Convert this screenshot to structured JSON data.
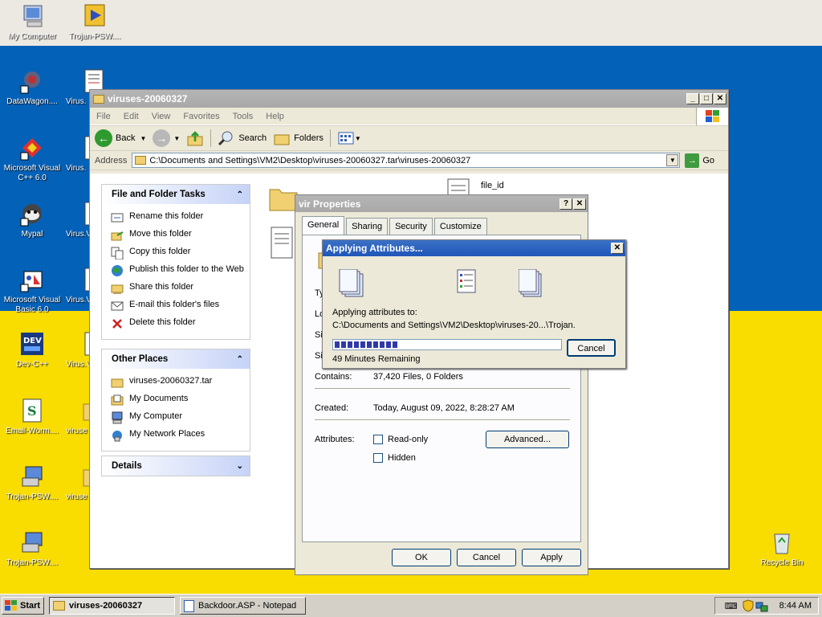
{
  "desktop": {
    "icons": [
      {
        "label": "My Computer"
      },
      {
        "label": "Trojan-PSW...."
      },
      {
        "label": "DataWagon...."
      },
      {
        "label": "Virus."
      },
      {
        "label": "Microsoft Visual C++ 6.0"
      },
      {
        "label": "Virus."
      },
      {
        "label": "Mypal"
      },
      {
        "label": "Virus.V"
      },
      {
        "label": "Microsoft Visual Basic 6.0"
      },
      {
        "label": "Virus.V"
      },
      {
        "label": "Dev-C++"
      },
      {
        "label": "Virus.V"
      },
      {
        "label": "Email-Worm...."
      },
      {
        "label": "viruse"
      },
      {
        "label": "Trojan-PSW...."
      },
      {
        "label": "viruse"
      },
      {
        "label": "Trojan-PSW...."
      },
      {
        "label": "Recycle Bin"
      }
    ]
  },
  "explorer": {
    "title": "viruses-20060327",
    "menu": [
      "File",
      "Edit",
      "View",
      "Favorites",
      "Tools",
      "Help"
    ],
    "toolbar": {
      "back": "Back",
      "search": "Search",
      "folders": "Folders"
    },
    "address_label": "Address",
    "address_value": "C:\\Documents and Settings\\VM2\\Desktop\\viruses-20060327.tar\\viruses-20060327",
    "go": "Go",
    "file_tasks": {
      "title": "File and Folder Tasks",
      "items": [
        "Rename this folder",
        "Move this folder",
        "Copy this folder",
        "Publish this folder to the Web",
        "Share this folder",
        "E-mail this folder's files",
        "Delete this folder"
      ]
    },
    "other_places": {
      "title": "Other Places",
      "items": [
        "viruses-20060327.tar",
        "My Documents",
        "My Computer",
        "My Network Places"
      ]
    },
    "details": {
      "title": "Details"
    },
    "files": [
      {
        "name": "file_id"
      }
    ]
  },
  "properties": {
    "title": "vir Properties",
    "tabs": [
      "General",
      "Sharing",
      "Security",
      "Customize"
    ],
    "partial_labels": [
      "Ty",
      "Lo",
      "Si",
      "Si"
    ],
    "contains_label": "Contains:",
    "contains_value": "37,420 Files, 0 Folders",
    "created_label": "Created:",
    "created_value": "Today, August 09, 2022, 8:28:27 AM",
    "attributes_label": "Attributes:",
    "readonly": "Read-only",
    "hidden": "Hidden",
    "advanced": "Advanced...",
    "ok": "OK",
    "cancel": "Cancel",
    "apply": "Apply"
  },
  "applying": {
    "title": "Applying Attributes...",
    "line1": "Applying attributes to:",
    "line2": "C:\\Documents and Settings\\VM2\\Desktop\\viruses-20...\\Trojan.",
    "remaining": "49 Minutes Remaining",
    "cancel": "Cancel",
    "progress": 0.28
  },
  "taskbar": {
    "start": "Start",
    "tasks": [
      "viruses-20060327",
      "Backdoor.ASP - Notepad"
    ],
    "clock": "8:44 AM"
  }
}
